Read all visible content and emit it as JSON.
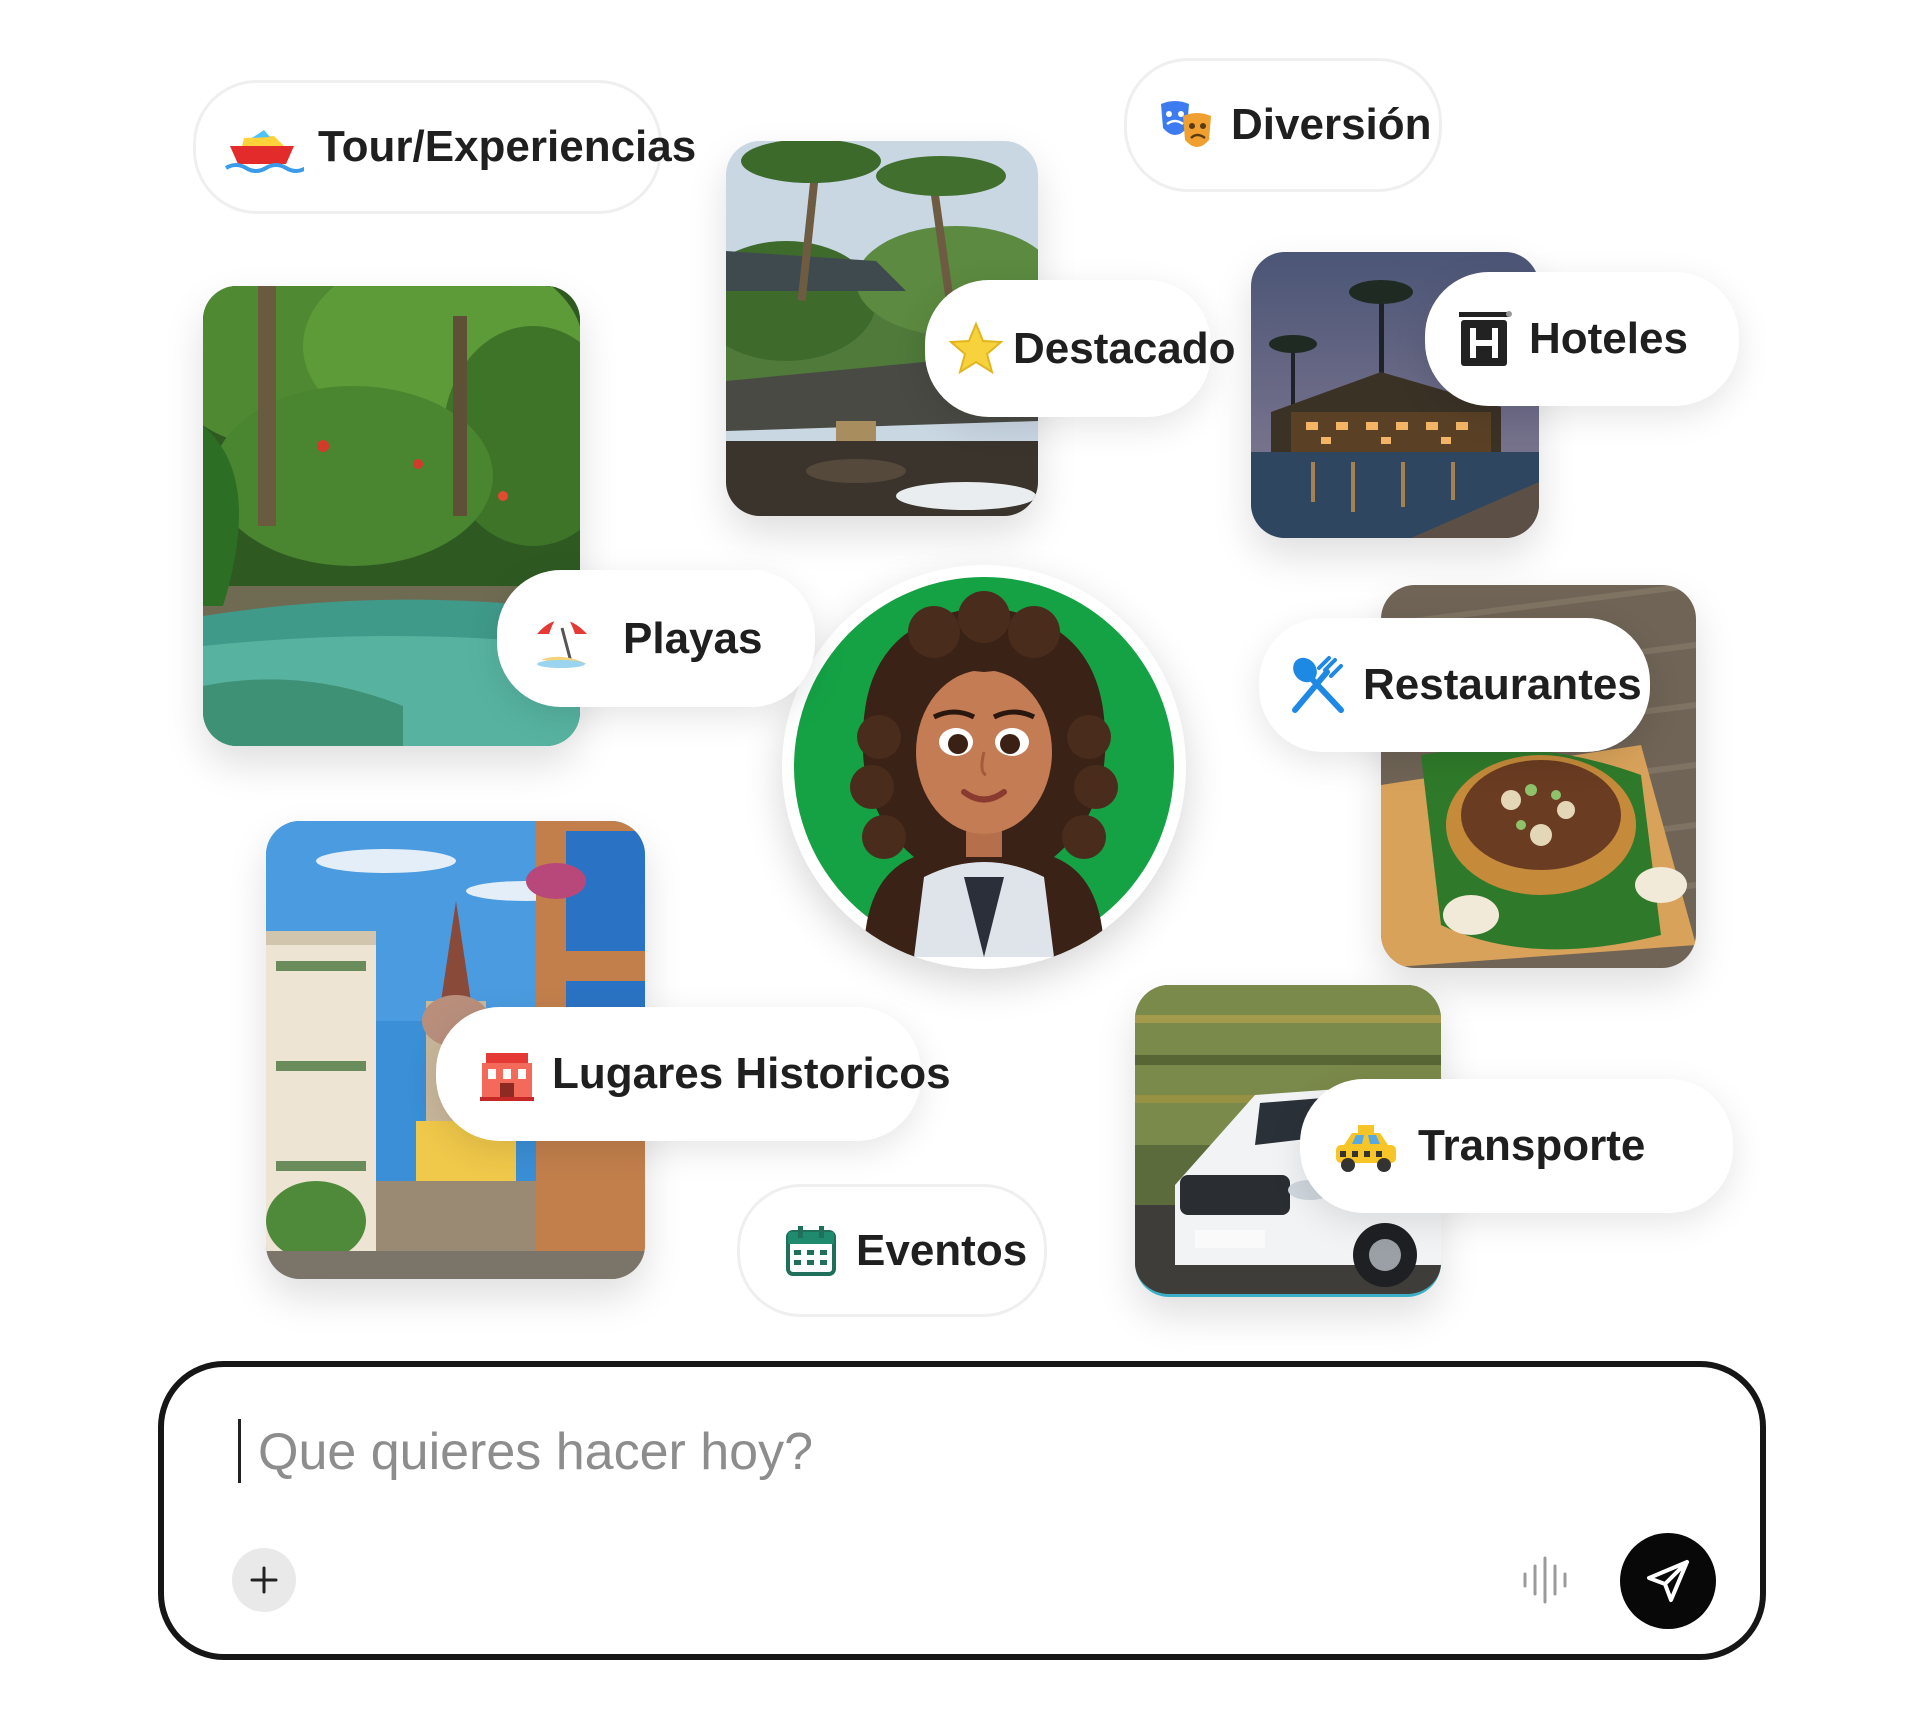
{
  "chips": {
    "tour": "Tour/Experiencias",
    "diversion": "Diversión",
    "destacado": "Destacado",
    "hoteles": "Hoteles",
    "playas": "Playas",
    "restaurantes": "Restaurantes",
    "lugares": "Lugares Historicos",
    "transporte": "Transporte",
    "eventos": "Eventos"
  },
  "icons": {
    "tour": "speedboat-icon",
    "diversion": "theater-masks-icon",
    "destacado": "star-icon",
    "hoteles": "hotel-icon",
    "playas": "beach-umbrella-icon",
    "restaurantes": "fork-spoon-icon",
    "lugares": "historic-building-icon",
    "transporte": "taxi-icon",
    "eventos": "calendar-icon"
  },
  "chat": {
    "placeholder": "Que quieres hacer hoy?"
  },
  "colors": {
    "avatar_ring": "#15a245",
    "send_button": "#080808",
    "chat_border": "#161616"
  }
}
